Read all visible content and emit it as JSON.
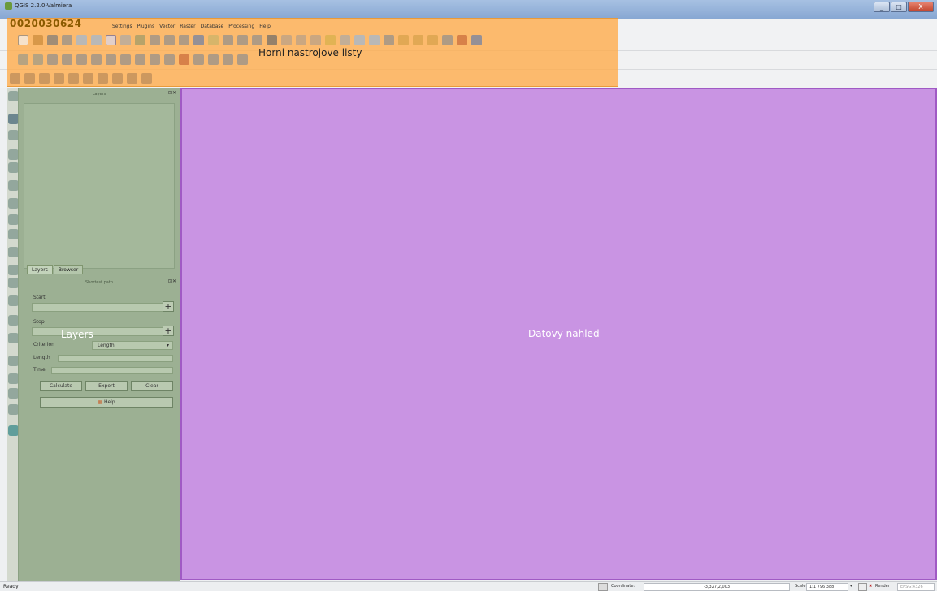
{
  "window": {
    "title": "QGIS 2.2.0-Valmiera",
    "controls": {
      "minimize": "_",
      "maximize": "□",
      "close": "X"
    }
  },
  "watermark": "0020030624",
  "menubar": {
    "items": [
      "Settings",
      "Plugins",
      "Vector",
      "Raster",
      "Database",
      "Processing",
      "Help"
    ]
  },
  "overlay": {
    "toolbars_label": "Horni nastrojove listy",
    "layers_label": "Layers",
    "map_label": "Datovy nahled",
    "toolbar_color": "#ffaa46",
    "panel_color": "#9cb093",
    "map_color": "#c994e3"
  },
  "layers_panel": {
    "title": "Layers",
    "tabs": [
      "Layers",
      "Browser"
    ]
  },
  "shortest_path": {
    "title": "Shortest path",
    "start_label": "Start",
    "stop_label": "Stop",
    "criterion_label": "Criterion",
    "criterion_value": "Length",
    "length_label": "Length",
    "time_label": "Time",
    "plus": "+",
    "buttons": {
      "calculate": "Calculate",
      "export": "Export",
      "clear": "Clear",
      "help": "Help"
    }
  },
  "statusbar": {
    "status": "Ready",
    "coordinate_label": "Coordinate:",
    "coordinate_value": "-3,327,2,003",
    "scale_label": "Scale",
    "scale_value": "1:1 796 388",
    "render_label": "Render",
    "crs": "EPSG:4326"
  }
}
